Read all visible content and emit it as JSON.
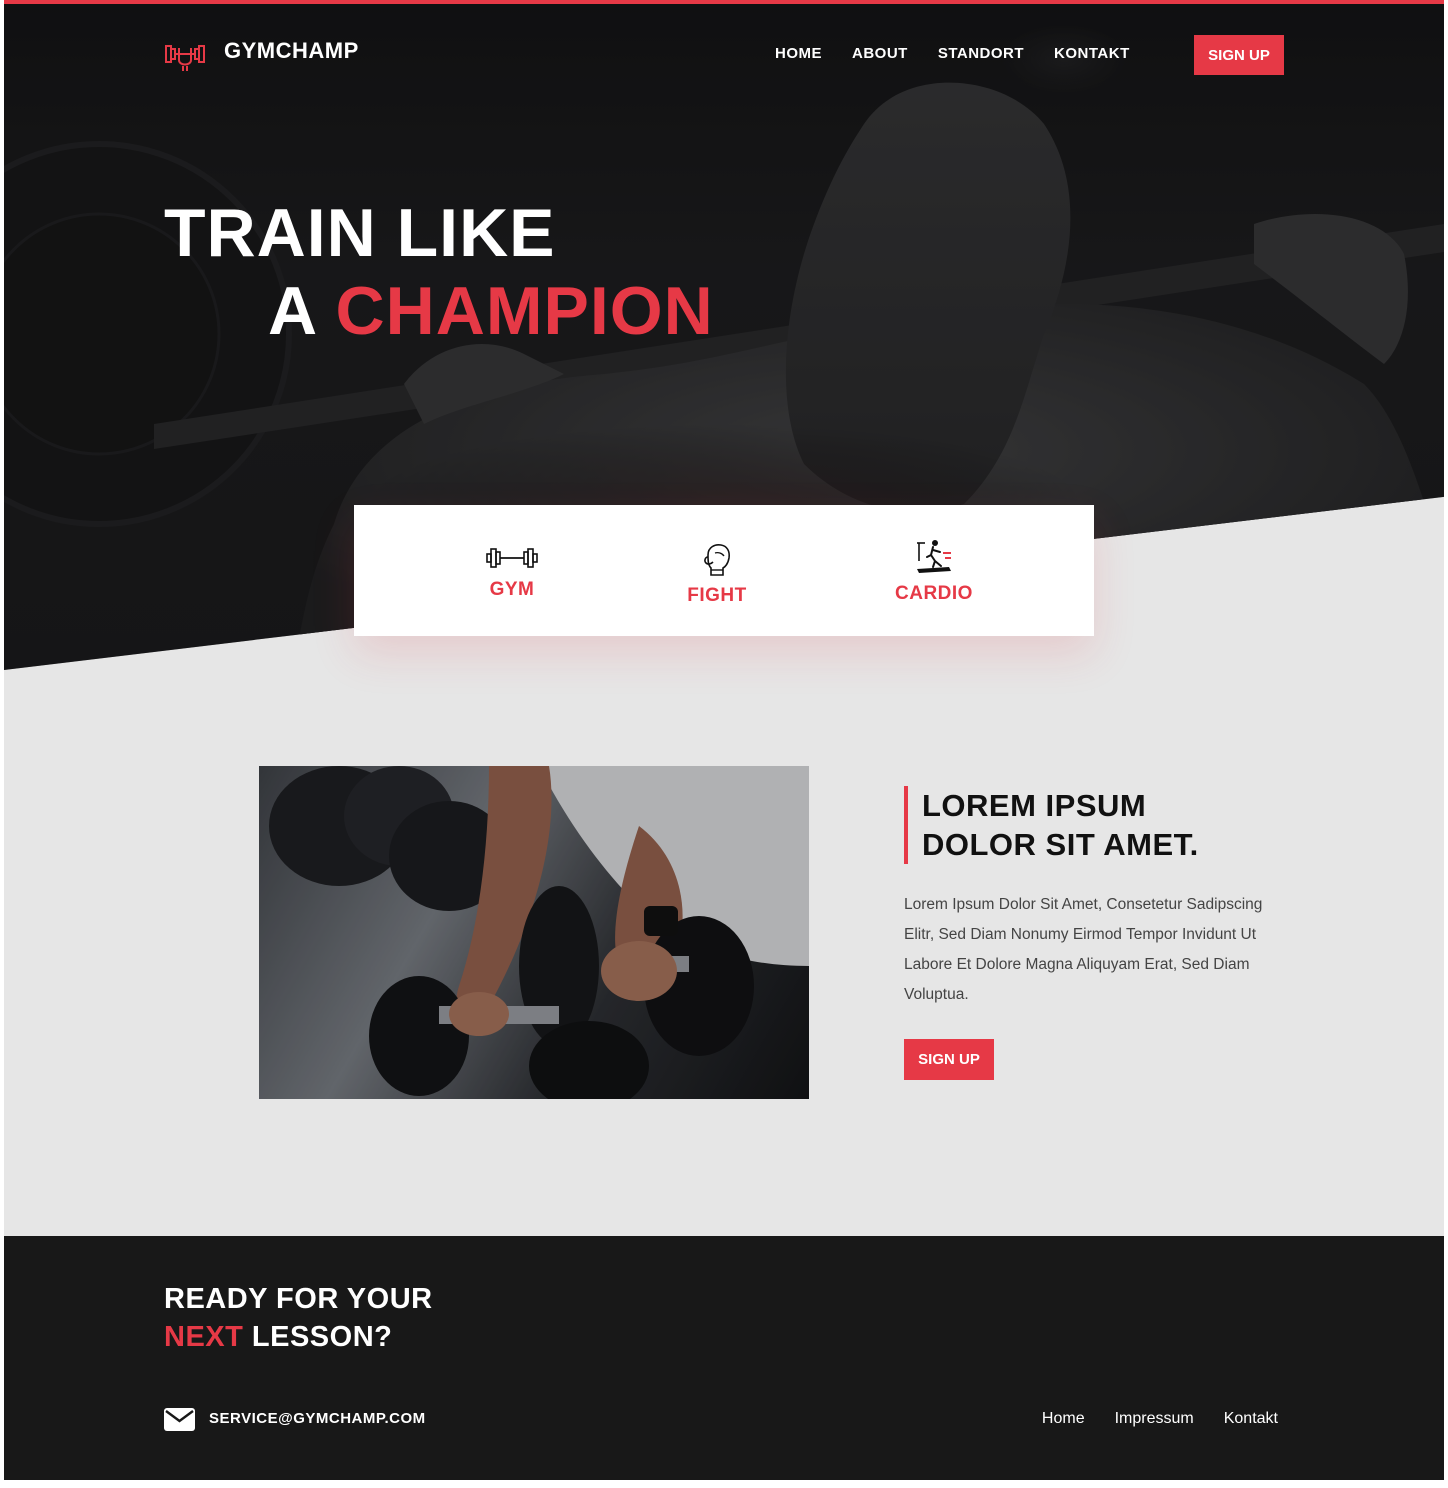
{
  "brand": {
    "name": "GYMCHAMP",
    "accent_color": "#e63946",
    "dark_color": "#181818"
  },
  "nav": {
    "links": [
      "HOME",
      "ABOUT",
      "STANDORT",
      "KONTAKT"
    ],
    "cta": "SIGN UP"
  },
  "hero": {
    "line1": "TRAIN LIKE",
    "line2_prefix": "A",
    "line2_accent": "CHAMPION"
  },
  "features": [
    {
      "label": "GYM",
      "icon": "dumbbell-icon"
    },
    {
      "label": "FIGHT",
      "icon": "boxing-glove-icon"
    },
    {
      "label": "CARDIO",
      "icon": "treadmill-icon"
    }
  ],
  "about": {
    "title_line1": "LOREM IPSUM",
    "title_line2": "DOLOR SIT AMET.",
    "text": "Lorem Ipsum Dolor Sit Amet, Consetetur Sadipscing Elitr, Sed Diam Nonumy Eirmod Tempor Invidunt Ut Labore Et Dolore Magna Aliquyam Erat, Sed Diam Voluptua.",
    "cta": "SIGN UP"
  },
  "footer": {
    "heading_line1": "READY FOR YOUR",
    "heading_accent": "NEXT",
    "heading_rest": "LESSON?",
    "email": "SERVICE@GYMCHAMP.COM",
    "links": [
      "Home",
      "Impressum",
      "Kontakt"
    ]
  }
}
